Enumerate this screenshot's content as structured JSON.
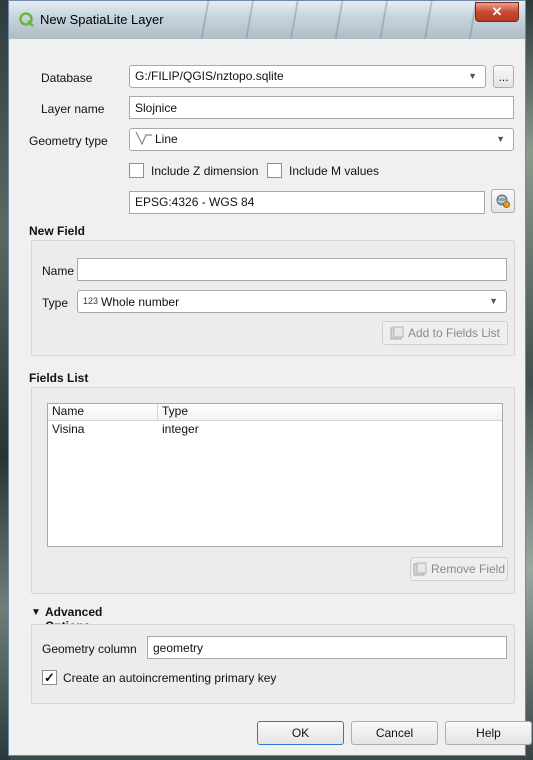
{
  "window": {
    "title": "New SpatiaLite Layer",
    "close_glyph": "✕"
  },
  "form": {
    "database_label": "Database",
    "database_value": "G:/FILIP/QGIS/nztopo.sqlite",
    "browse_label": "...",
    "layer_name_label": "Layer name",
    "layer_name_value": "Slojnice",
    "geometry_type_label": "Geometry type",
    "geometry_type_value": "Line",
    "include_z_label": "Include Z dimension",
    "include_z_checked": false,
    "include_m_label": "Include M values",
    "include_m_checked": false,
    "crs_value": "EPSG:4326 - WGS 84"
  },
  "new_field": {
    "title": "New Field",
    "name_label": "Name",
    "name_value": "",
    "type_label": "Type",
    "type_prefix": "123",
    "type_value": "Whole number",
    "add_button": "Add to Fields List"
  },
  "fields_list": {
    "title": "Fields List",
    "columns": [
      "Name",
      "Type"
    ],
    "rows": [
      {
        "name": "Visina",
        "type": "integer"
      }
    ],
    "remove_button": "Remove Field"
  },
  "advanced": {
    "title": "Advanced Options",
    "geometry_column_label": "Geometry column",
    "geometry_column_value": "geometry",
    "primary_key_label": "Create an autoincrementing primary key",
    "primary_key_checked": true,
    "check_glyph": "✓"
  },
  "buttons": {
    "ok": "OK",
    "cancel": "Cancel",
    "help": "Help"
  },
  "colors": {
    "qgis_green": "#6bb33a",
    "accent_border": "#2d7ad6"
  }
}
